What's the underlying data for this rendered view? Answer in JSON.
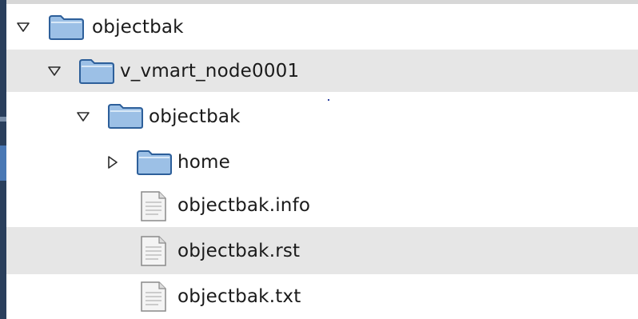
{
  "tree": {
    "rows": [
      {
        "label": "objectbak",
        "type": "folder",
        "state": "expanded",
        "depth": 0
      },
      {
        "label": "v_vmart_node0001",
        "type": "folder",
        "state": "expanded",
        "depth": 1
      },
      {
        "label": "objectbak",
        "type": "folder",
        "state": "expanded",
        "depth": 2
      },
      {
        "label": "home",
        "type": "folder",
        "state": "collapsed",
        "depth": 3
      },
      {
        "label": "objectbak.info",
        "type": "file",
        "depth": 3
      },
      {
        "label": "objectbak.rst",
        "type": "file",
        "depth": 3
      },
      {
        "label": "objectbak.txt",
        "type": "file",
        "depth": 3
      }
    ]
  },
  "colors": {
    "folder_fill": "#9cc0e6",
    "folder_stroke": "#2d5f9a",
    "row_alt": "#e6e6e6",
    "left_edge": "#2a3f5c"
  },
  "icons": {
    "expanded": "triangle-down-icon",
    "collapsed": "triangle-right-icon",
    "folder": "folder-icon",
    "file": "file-icon"
  }
}
